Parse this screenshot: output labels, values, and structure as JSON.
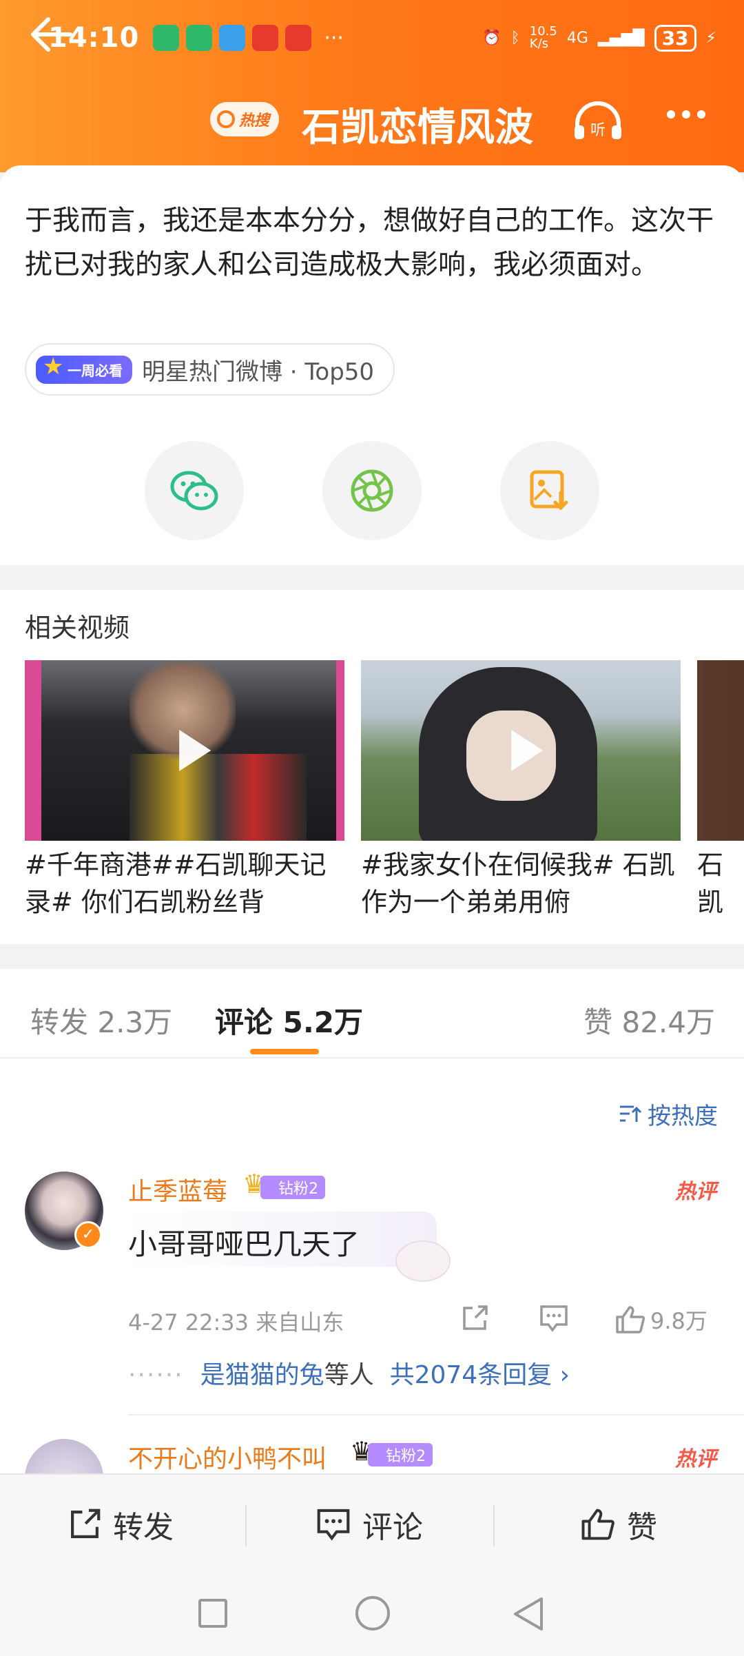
{
  "status_bar": {
    "time": "14:10",
    "network_speed": "10.5\nK/s",
    "network": "4G",
    "battery": "33"
  },
  "header": {
    "hot_badge": "热搜",
    "title": "石凯恋情风波",
    "listen_label": "听"
  },
  "post": {
    "content": "于我而言，我还是本本分分，想做好自己的工作。这次干扰已对我的家人和公司造成极大影响，我必须面对。",
    "tag_pill": "一周必看",
    "tag_label": "明星热门微博 · Top50"
  },
  "related_videos": {
    "title": "相关视频",
    "items": [
      {
        "caption": "#千年商港##石凯聊天记录# 你们石凯粉丝背"
      },
      {
        "caption": "#我家女仆在伺候我# 石凯作为一个弟弟用俯"
      },
      {
        "caption": "石凯班，"
      }
    ]
  },
  "tabs": {
    "repost": "转发 2.3万",
    "comment": "评论 5.2万",
    "like": "赞 82.4万"
  },
  "sort_label": "按热度",
  "comments": [
    {
      "username": "止季蓝莓",
      "fan_badge": "钻粉2",
      "hot_label": "热评",
      "text": "小哥哥哑巴几天了",
      "meta": "4-27 22:33 来自山东",
      "likes": "9.8万",
      "reply_names": "是猫猫的兔",
      "reply_mid": "等人",
      "reply_count": "共2074条回复 ›"
    },
    {
      "username": "不开心的小鸭不叫",
      "fan_badge": "钻粉2",
      "hot_label": "热评"
    }
  ],
  "bottom_bar": {
    "repost": "转发",
    "comment": "评论",
    "like": "赞"
  },
  "colors": {
    "header_orange": "#ff7a1a",
    "link_blue": "#3c70b8",
    "username_orange": "#eb7a1a",
    "hot_red": "#f45a4a"
  }
}
